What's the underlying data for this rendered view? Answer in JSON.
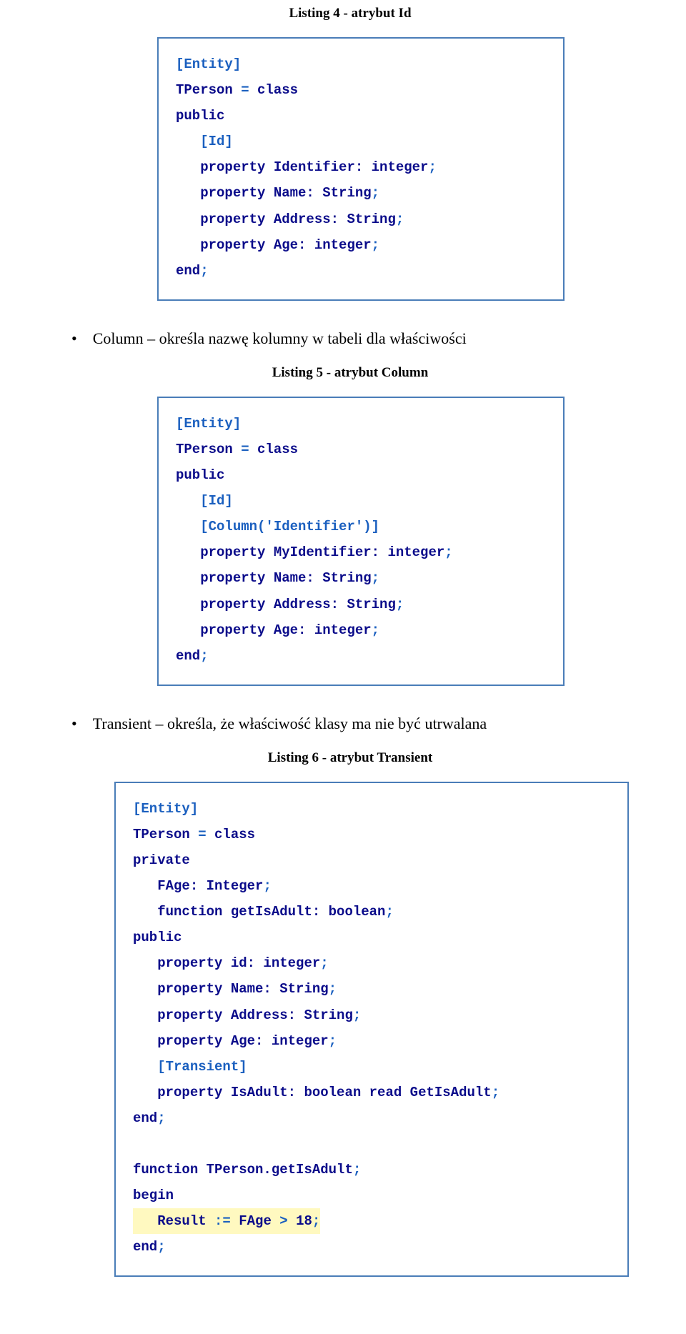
{
  "captions": {
    "l4": "Listing 4 - atrybut Id",
    "l5": "Listing 5 - atrybut Column",
    "l6": "Listing 6 - atrybut Transient"
  },
  "bullets": {
    "column": "Column – określa nazwę kolumny w tabeli dla właściwości",
    "transient": "Transient – określa, że właściwość klasy ma nie być utrwalana"
  },
  "code4": {
    "l1a": "[Entity]",
    "l2a": "TPerson ",
    "l2b": "=",
    "l2c": " class",
    "l3a": "public",
    "l4a": "   [Id]",
    "l5a": "   property",
    "l5b": " Identifier: integer",
    "l6a": "   property",
    "l6b": " Name: String",
    "l7a": "   property",
    "l7b": " Address: String",
    "l8a": "   property",
    "l8b": " Age: integer",
    "l9a": "end"
  },
  "code5": {
    "l1a": "[Entity]",
    "l2a": "TPerson ",
    "l2b": "=",
    "l2c": " class",
    "l3a": "public",
    "l4a": "   [Id]",
    "l5a": "   [Column(",
    "l5b": "'Identifier'",
    "l5c": ")]",
    "l6a": "   property",
    "l6b": " MyIdentifier: integer",
    "l7a": "   property",
    "l7b": " Name: String",
    "l8a": "   property",
    "l8b": " Address: String",
    "l9a": "   property",
    "l9b": " Age: integer",
    "l10a": "end"
  },
  "code6": {
    "l1a": "[Entity]",
    "l2a": "TPerson ",
    "l2b": "=",
    "l2c": " class",
    "l3a": "private",
    "l4a": "   FAge: Integer",
    "l5a": "   function",
    "l5b": " getIsAdult: boolean",
    "l6a": "public",
    "l7a": "   property",
    "l7b": " id: integer",
    "l8a": "   property",
    "l8b": " Name: String",
    "l9a": "   property",
    "l9b": " Address: String",
    "l10a": "   property",
    "l10b": " Age: integer",
    "l11a": "   [Transient]",
    "l12a": "   property",
    "l12b": " IsAdult: boolean ",
    "l12c": "read",
    "l12d": " GetIsAdult",
    "l13a": "end",
    "l15a": "function",
    "l15b": " TPerson.getIsAdult",
    "l16a": "begin",
    "l17a": "   Result ",
    "l17b": ":=",
    "l17c": " FAge ",
    "l17d": ">",
    "l17e": " 18",
    "l18a": "end"
  }
}
